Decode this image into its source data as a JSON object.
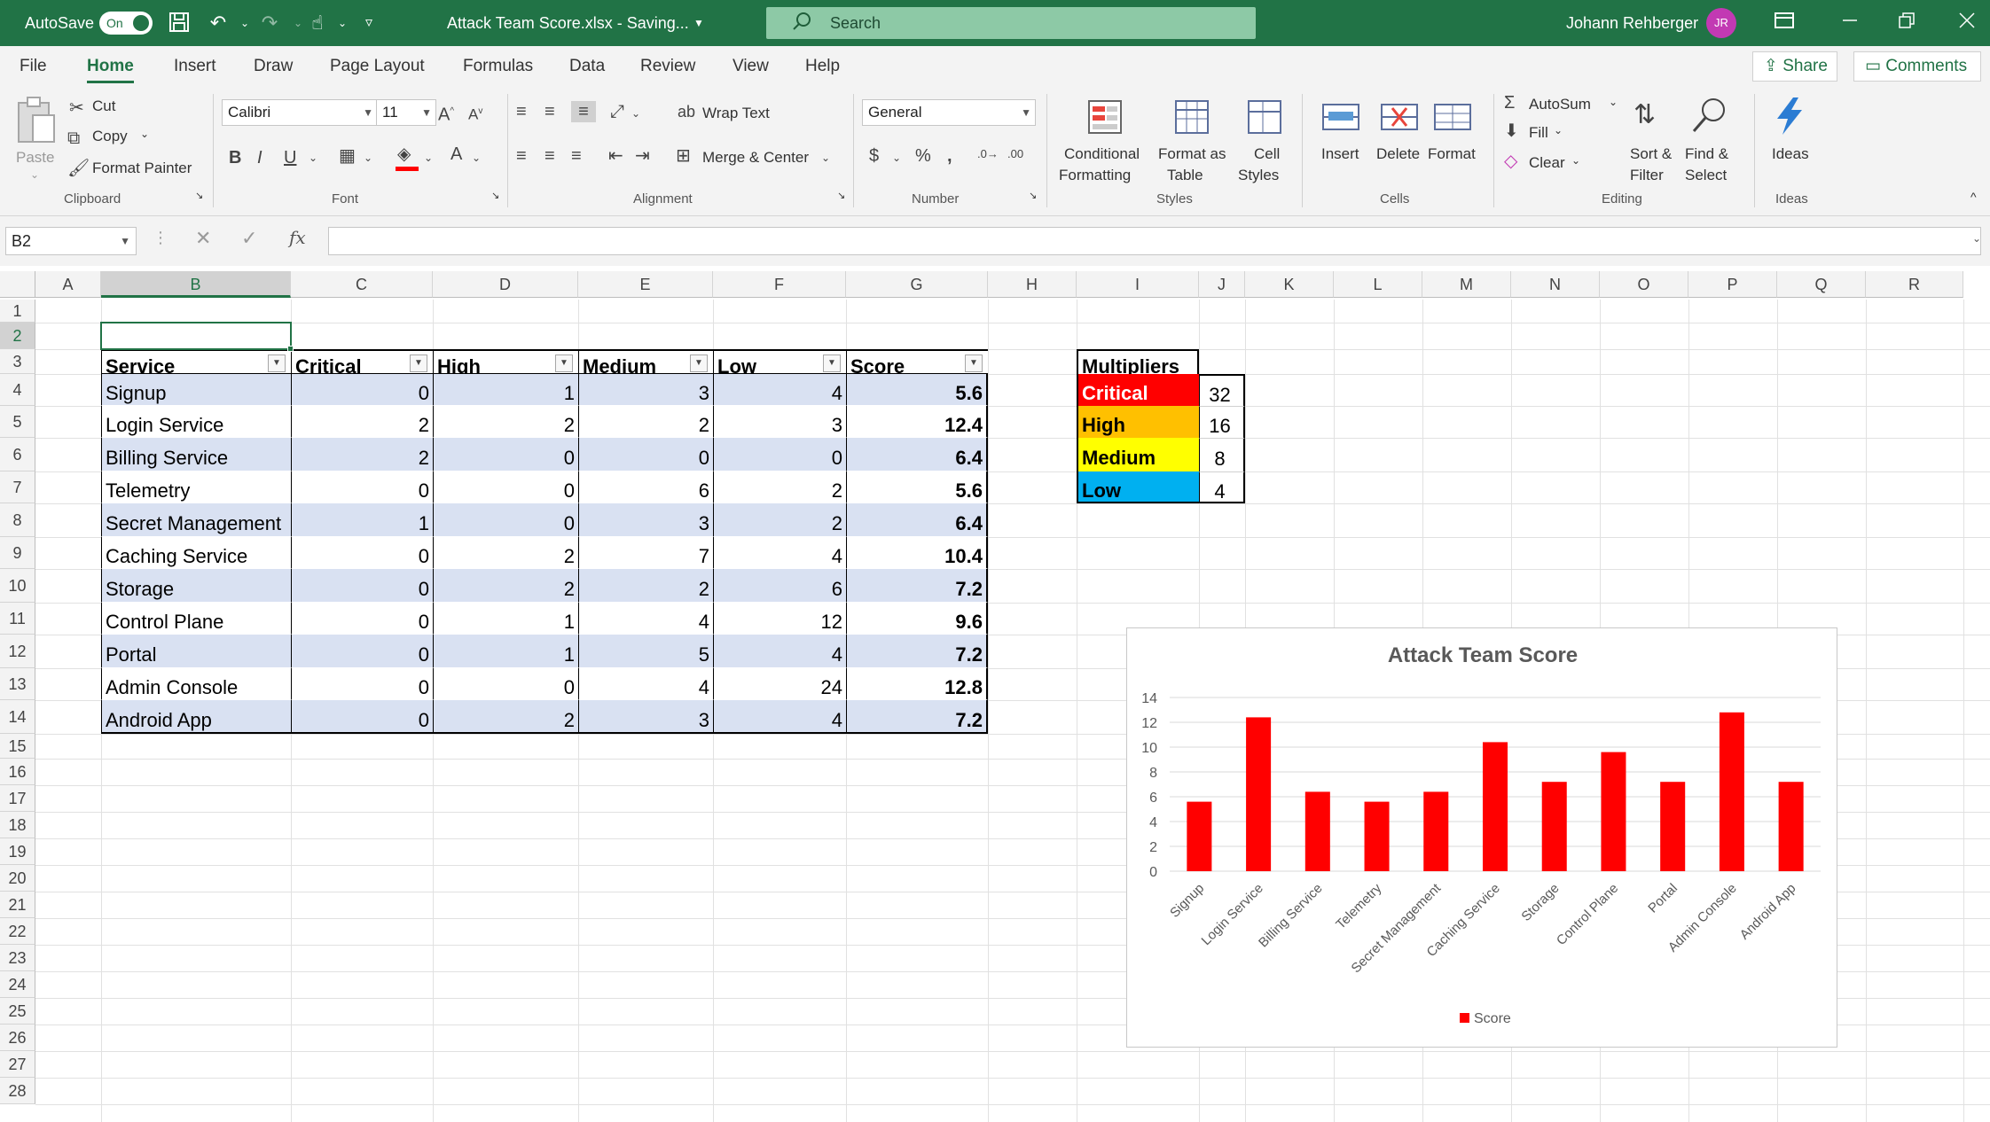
{
  "titlebar": {
    "autosave_label": "AutoSave",
    "autosave_state": "On",
    "file_status": "Attack Team Score.xlsx  -  Saving...",
    "search_placeholder": "Search",
    "user_name": "Johann Rehberger",
    "user_initials": "JR"
  },
  "menu": {
    "tabs": [
      "File",
      "Home",
      "Insert",
      "Draw",
      "Page Layout",
      "Formulas",
      "Data",
      "Review",
      "View",
      "Help"
    ],
    "share_label": "Share",
    "comments_label": "Comments"
  },
  "ribbon": {
    "clipboard": {
      "paste": "Paste",
      "cut": "Cut",
      "copy": "Copy",
      "format_painter": "Format Painter",
      "group": "Clipboard"
    },
    "font": {
      "family": "Calibri",
      "size": "11",
      "group": "Font"
    },
    "alignment": {
      "wrap_text": "Wrap Text",
      "merge_center": "Merge & Center",
      "group": "Alignment"
    },
    "number": {
      "format": "General",
      "group": "Number"
    },
    "styles": {
      "conditional_1": "Conditional",
      "conditional_2": "Formatting",
      "format_as_1": "Format as",
      "format_as_2": "Table",
      "cell_1": "Cell",
      "cell_2": "Styles",
      "group": "Styles"
    },
    "cells": {
      "insert": "Insert",
      "delete": "Delete",
      "format": "Format",
      "group": "Cells"
    },
    "editing": {
      "autosum": "AutoSum",
      "fill": "Fill",
      "clear": "Clear",
      "sort_1": "Sort &",
      "sort_2": "Filter",
      "find_1": "Find &",
      "find_2": "Select",
      "group": "Editing"
    },
    "ideas": {
      "label": "Ideas",
      "group": "Ideas"
    }
  },
  "formula_bar": {
    "name_box": "B2",
    "fx": "fx",
    "content": ""
  },
  "grid": {
    "columns": [
      "A",
      "B",
      "C",
      "D",
      "E",
      "F",
      "G",
      "H",
      "I",
      "J",
      "K",
      "L",
      "M",
      "N",
      "O",
      "P",
      "Q",
      "R"
    ],
    "rows": [
      "1",
      "2",
      "3",
      "4",
      "5",
      "6",
      "7",
      "8",
      "9",
      "10",
      "11",
      "12",
      "13",
      "14",
      "15",
      "16",
      "17",
      "18",
      "19",
      "20",
      "21",
      "22",
      "23",
      "24",
      "25",
      "26",
      "27",
      "28"
    ]
  },
  "table": {
    "headers": [
      "Service",
      "Critical",
      "High",
      "Medium",
      "Low",
      "Score"
    ],
    "rows": [
      [
        "Signup",
        "0",
        "1",
        "3",
        "4",
        "5.6"
      ],
      [
        "Login Service",
        "2",
        "2",
        "2",
        "3",
        "12.4"
      ],
      [
        "Billing Service",
        "2",
        "0",
        "0",
        "0",
        "6.4"
      ],
      [
        "Telemetry",
        "0",
        "0",
        "6",
        "2",
        "5.6"
      ],
      [
        "Secret Management",
        "1",
        "0",
        "3",
        "2",
        "6.4"
      ],
      [
        "Caching Service",
        "0",
        "2",
        "7",
        "4",
        "10.4"
      ],
      [
        "Storage",
        "0",
        "2",
        "2",
        "6",
        "7.2"
      ],
      [
        "Control Plane",
        "0",
        "1",
        "4",
        "12",
        "9.6"
      ],
      [
        "Portal",
        "0",
        "1",
        "5",
        "4",
        "7.2"
      ],
      [
        "Admin Console",
        "0",
        "0",
        "4",
        "24",
        "12.8"
      ],
      [
        "Android App",
        "0",
        "2",
        "3",
        "4",
        "7.2"
      ]
    ],
    "band_color": "#d9e1f2"
  },
  "multipliers": {
    "title": "Multipliers",
    "rows": [
      {
        "label": "Critical",
        "value": "32",
        "color": "#ff0000"
      },
      {
        "label": "High",
        "value": "16",
        "color": "#ffc000"
      },
      {
        "label": "Medium",
        "value": "8",
        "color": "#ffff00"
      },
      {
        "label": "Low",
        "value": "4",
        "color": "#00b0f0"
      }
    ]
  },
  "chart_data": {
    "type": "bar",
    "title": "Attack Team Score",
    "categories": [
      "Signup",
      "Login Service",
      "Billing Service",
      "Telemetry",
      "Secret Management",
      "Caching Service",
      "Storage",
      "Control Plane",
      "Portal",
      "Admin Console",
      "Android App"
    ],
    "series": [
      {
        "name": "Score",
        "values": [
          5.6,
          12.4,
          6.4,
          5.6,
          6.4,
          10.4,
          7.2,
          9.6,
          7.2,
          12.8,
          7.2
        ],
        "color": "#ff0000"
      }
    ],
    "ylim": [
      0,
      14
    ],
    "yticks": [
      0,
      2,
      4,
      6,
      8,
      10,
      12,
      14
    ],
    "grid": true,
    "legend": "bottom"
  },
  "colors": {
    "accent": "#217346",
    "selection": "#217346"
  }
}
